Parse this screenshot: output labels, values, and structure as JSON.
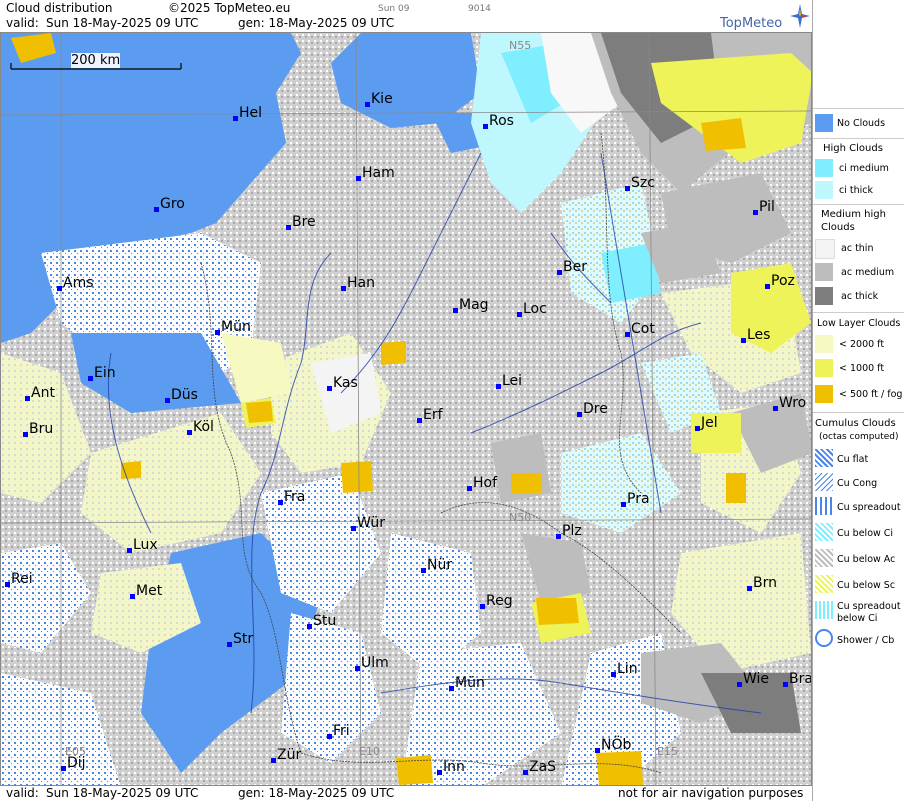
{
  "header": {
    "title": "Cloud distribution",
    "copyright": "©2025 TopMeteo.eu",
    "tab_time": "Sun 09",
    "code": "9014",
    "valid_label": "valid:",
    "valid_value": "Sun  18-May-2025  09 UTC",
    "gen_label": "gen: 18-May-2025 09 UTC",
    "brand": "TopMeteo"
  },
  "footer": {
    "valid_label": "valid:",
    "valid_value": "Sun  18-May-2025  09 UTC",
    "gen_label": "gen: 18-May-2025 09 UTC",
    "note": "not for air navigation purposes"
  },
  "map": {
    "scale_label": "200 km",
    "grid_labels": [
      "N55",
      "N50",
      "E05",
      "E10",
      "E15"
    ],
    "cities": [
      "Hel",
      "Kie",
      "Ros",
      "Ham",
      "Szc",
      "Gro",
      "Bre",
      "Pil",
      "Ams",
      "Han",
      "Ber",
      "Poz",
      "Mün",
      "Mag",
      "Loc",
      "Cot",
      "Les",
      "Ein",
      "Kas",
      "Lei",
      "Ant",
      "Düs",
      "Erf",
      "Dre",
      "Wro",
      "Bru",
      "Köl",
      "Jel",
      "Hof",
      "Fra",
      "Pra",
      "Würz",
      "Plz",
      "Lux",
      "Nür",
      "Rei",
      "Met",
      "Reg",
      "Brn",
      "Stu",
      "Str",
      "Ulm",
      "Lin",
      "Wie",
      "Bra",
      "Mün2",
      "Fri",
      "Dij",
      "Zür",
      "Inn",
      "ZaS",
      "NÖb"
    ],
    "city_labels": {
      "Hel": "Hel",
      "Kie": "Kie",
      "Ros": "Ros",
      "Ham": "Ham",
      "Szc": "Szc",
      "Gro": "Gro",
      "Bre": "Bre",
      "Pil": "Pil",
      "Ams": "Ams",
      "Han": "Han",
      "Ber": "Ber",
      "Poz": "Poz",
      "Mün": "Mün",
      "Mag": "Mag",
      "Loc": "Loc",
      "Cot": "Cot",
      "Les": "Les",
      "Ein": "Ein",
      "Kas": "Kas",
      "Lei": "Lei",
      "Ant": "Ant",
      "Düs": "Düs",
      "Erf": "Erf",
      "Dre": "Dre",
      "Wro": "Wro",
      "Bru": "Bru",
      "Köl": "Köl",
      "Jel": "Jel",
      "Hof": "Hof",
      "Fra": "Fra",
      "Pra": "Pra",
      "Würz": "Wür",
      "Plz": "Plz",
      "Lux": "Lux",
      "Nür": "Nür",
      "Rei": "Rei",
      "Met": "Met",
      "Reg": "Reg",
      "Brn": "Brn",
      "Stu": "Stu",
      "Str": "Str",
      "Ulm": "Ulm",
      "Lin": "Lin",
      "Wie": "Wie",
      "Bra": "Bra",
      "Mün2": "Mün",
      "Fri": "Fri",
      "Dij": "Dij",
      "Zür": "Zür",
      "Inn": "Inn",
      "ZaS": "ZaS",
      "NÖb": "NÖb"
    }
  },
  "legend": {
    "no_clouds": "No Clouds",
    "high_title": "High Clouds",
    "ci_medium": "ci medium",
    "ci_thick": "ci thick",
    "medium_title_1": "Medium high",
    "medium_title_2": "Clouds",
    "ac_thin": "ac thin",
    "ac_medium": "ac medium",
    "ac_thick": "ac thick",
    "low_title": "Low Layer Clouds",
    "low_2000": "< 2000 ft",
    "low_1000": "< 1000 ft",
    "low_500": "< 500 ft / fog",
    "cumulus_title": "Cumulus Clouds",
    "cumulus_sub": "(octas computed)",
    "cu_flat": "Cu flat",
    "cu_cong": "Cu Cong",
    "cu_spread": "Cu spreadout",
    "cu_below_ci": "Cu below Ci",
    "cu_below_ac": "Cu below Ac",
    "cu_below_sc": "Cu below Sc",
    "cu_spread_ci_1": "Cu spreadout",
    "cu_spread_ci_2": "below Ci",
    "shower": "Shower / Cb",
    "colors": {
      "no_clouds": "#5b9cf0",
      "ci_medium": "#7fefff",
      "ci_thick": "#bff7ff",
      "ac_thin": "#f4f4f4",
      "ac_medium": "#bdbdbd",
      "ac_thick": "#7d7d7d",
      "low_2000": "#f6f9c0",
      "low_1000": "#eef35a",
      "low_500": "#f0c000"
    }
  }
}
